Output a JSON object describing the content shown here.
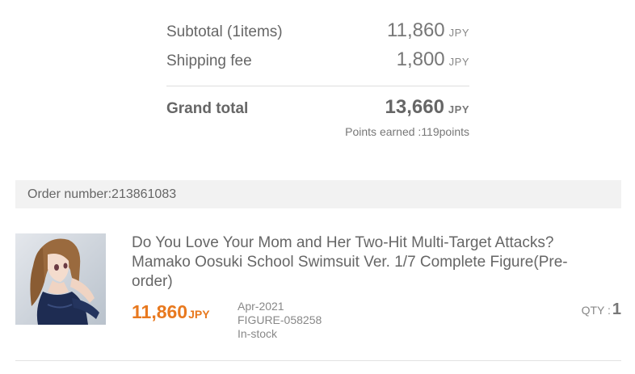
{
  "summary": {
    "subtotal_label": "Subtotal (1items)",
    "subtotal_amount": "11,860",
    "shipping_label": "Shipping fee",
    "shipping_amount": "1,800",
    "grand_label": "Grand total",
    "grand_amount": "13,660",
    "currency": "JPY",
    "points_text": "Points earned :119points"
  },
  "order": {
    "number_text": "Order number:213861083"
  },
  "item": {
    "title": "Do You Love Your Mom and Her Two-Hit Multi-Target Attacks? Mamako Oosuki School Swimsuit Ver. 1/7 Complete Figure(Pre-order)",
    "price": "11,860",
    "currency": "JPY",
    "release": "Apr-2021",
    "code": "FIGURE-058258",
    "stock": "In-stock",
    "qty_label": "QTY :",
    "qty_value": "1",
    "image_icon": "product-thumbnail"
  },
  "colors": {
    "price_accent": "#e8791f",
    "order_bar_bg": "#f2f2f2"
  }
}
